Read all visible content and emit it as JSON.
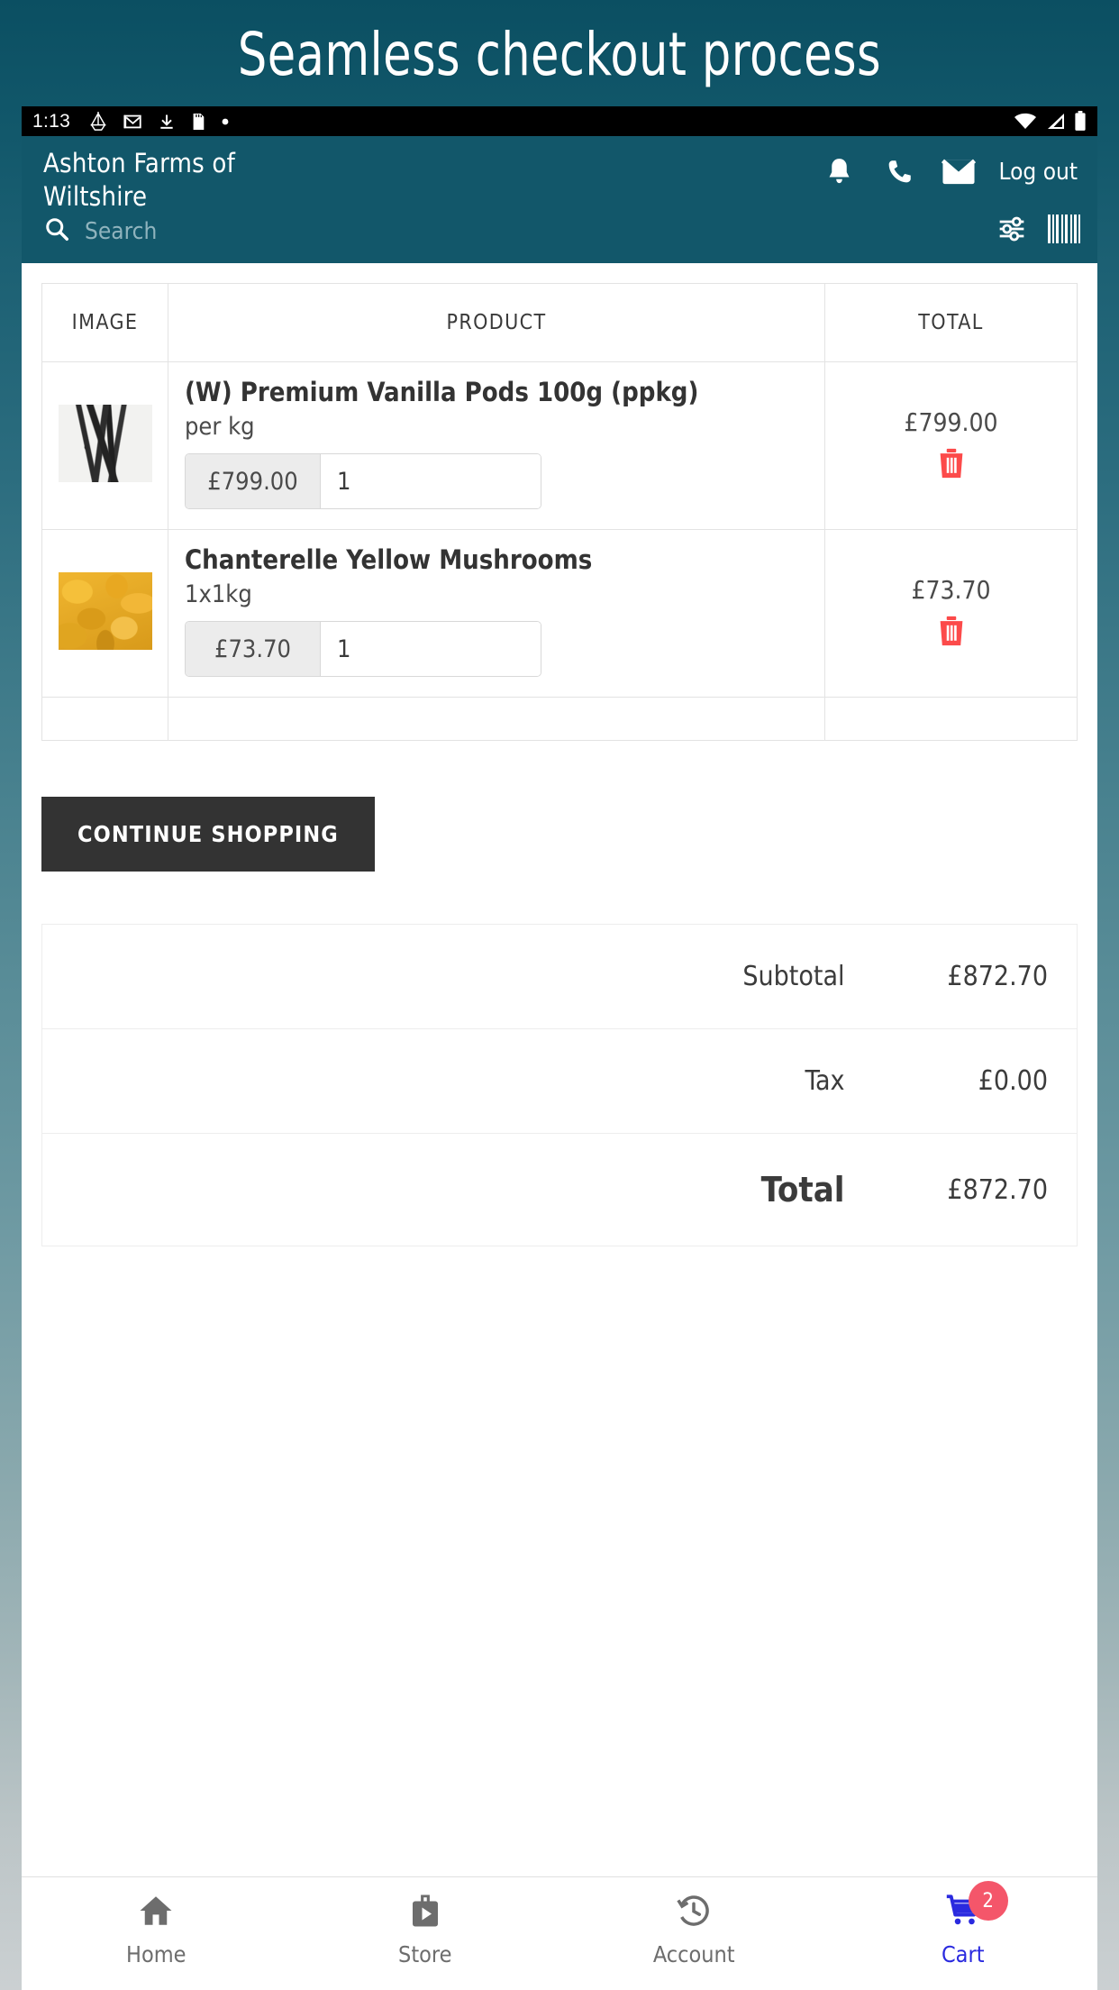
{
  "hero": {
    "title": "Seamless checkout process"
  },
  "status_bar": {
    "time": "1:13",
    "left_icons": [
      "drive-icon",
      "gmail-icon",
      "download-icon",
      "sd-card-icon",
      "dot-icon"
    ],
    "right_icons": [
      "wifi-icon",
      "signal-icon",
      "battery-icon"
    ]
  },
  "app_bar": {
    "brand_line1": "Ashton Farms of",
    "brand_line2": "Wiltshire",
    "actions": [
      "notifications-icon",
      "phone-icon",
      "mail-icon"
    ],
    "logout_label": "Log out",
    "accent_color": "#12576a"
  },
  "search": {
    "placeholder": "Search",
    "value": "",
    "filter_icon": "sliders-icon",
    "barcode_icon": "barcode-icon"
  },
  "cart": {
    "columns": [
      "IMAGE",
      "PRODUCT",
      "TOTAL"
    ],
    "items": [
      {
        "image": "vanilla-pods-thumbnail",
        "name": "(W) Premium Vanilla Pods 100g (ppkg)",
        "unit": "per kg",
        "price": "£799.00",
        "quantity": "1",
        "total": "£799.00",
        "remove_icon": "trash-icon"
      },
      {
        "image": "chanterelle-mushrooms-thumbnail",
        "name": "Chanterelle Yellow Mushrooms",
        "unit": "1x1kg",
        "price": "£73.70",
        "quantity": "1",
        "total": "£73.70",
        "remove_icon": "trash-icon"
      }
    ],
    "continue_shopping_label": "CONTINUE SHOPPING",
    "summary": [
      {
        "label": "Subtotal",
        "value": "£872.70"
      },
      {
        "label": "Tax",
        "value": "£0.00"
      },
      {
        "label": "Total",
        "value": "£872.70"
      }
    ]
  },
  "bottom_nav": {
    "items": [
      {
        "label": "Home",
        "icon": "home-icon",
        "active": false
      },
      {
        "label": "Store",
        "icon": "store-icon",
        "active": false
      },
      {
        "label": "Account",
        "icon": "history-icon",
        "active": false
      },
      {
        "label": "Cart",
        "icon": "cart-icon",
        "active": true,
        "badge": "2"
      }
    ],
    "active_color": "#2a2adf",
    "badge_color": "#f4566a"
  }
}
